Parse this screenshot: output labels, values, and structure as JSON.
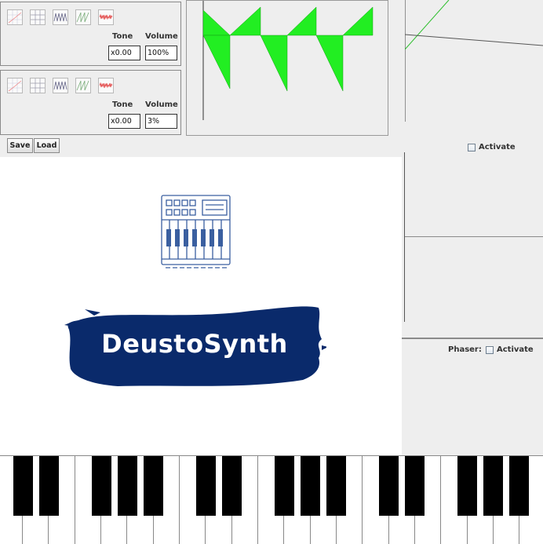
{
  "oscillators": [
    {
      "tone_label": "Tone",
      "volume_label": "Volume",
      "tone_value": "x0.00",
      "volume_value": "100%"
    },
    {
      "tone_label": "Tone",
      "volume_label": "Volume",
      "tone_value": "x0.00",
      "volume_value": "3%"
    }
  ],
  "wave_buttons": [
    "sine-wave-icon",
    "square-wave-icon",
    "triangle-wave-icon",
    "sawtooth-wave-icon",
    "noise-wave-icon"
  ],
  "toolbar": {
    "save_label": "Save",
    "load_label": "Load"
  },
  "logo": {
    "text": "DeustoSynth",
    "brush_color": "#0a2a6b"
  },
  "effects": {
    "top_activate_label": "Activate",
    "phaser_label": "Phaser:",
    "phaser_activate_label": "Activate"
  },
  "colors": {
    "waveform": "#22ee22",
    "envelope_line": "#2fbf2f"
  }
}
